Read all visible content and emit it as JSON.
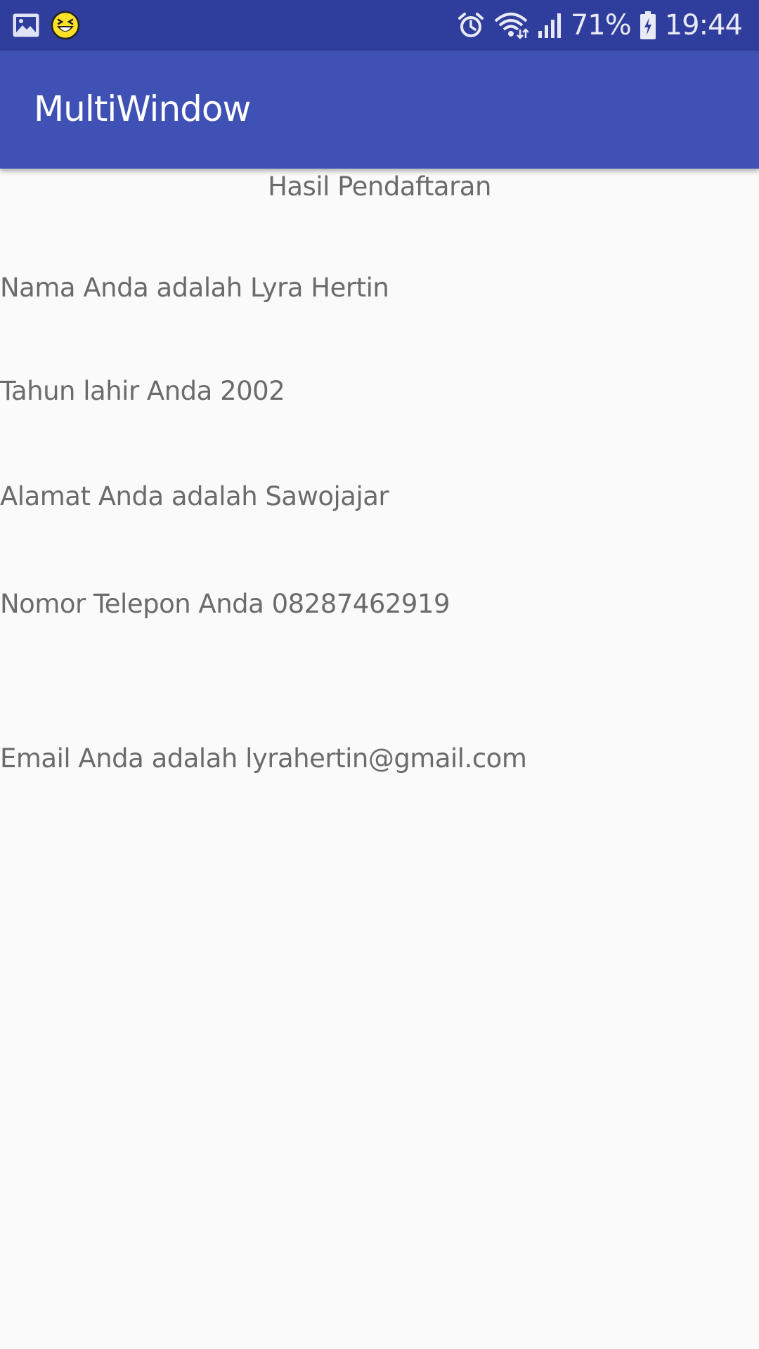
{
  "status_bar": {
    "left_icons": [
      "gallery-image-icon",
      "smiley-face-icon"
    ],
    "right_icons": [
      "alarm-icon",
      "wifi-icon",
      "signal-icon",
      "battery-charging-icon"
    ],
    "battery_percent": "71%",
    "time": "19:44"
  },
  "app_bar": {
    "title": "MultiWindow"
  },
  "content": {
    "heading": "Hasil Pendaftaran",
    "name_line": "Nama Anda adalah Lyra Hertin",
    "birth_year_line": "Tahun lahir Anda 2002",
    "address_line": "Alamat Anda adalah Sawojajar",
    "phone_line": "Nomor Telepon Anda 08287462919",
    "email_line": "Email Anda adalah lyrahertin@gmail.com"
  },
  "colors": {
    "status_bar": "#2f3d9c",
    "app_bar": "#3f51b5",
    "background": "#fafafa",
    "text": "#6b6b6b"
  }
}
